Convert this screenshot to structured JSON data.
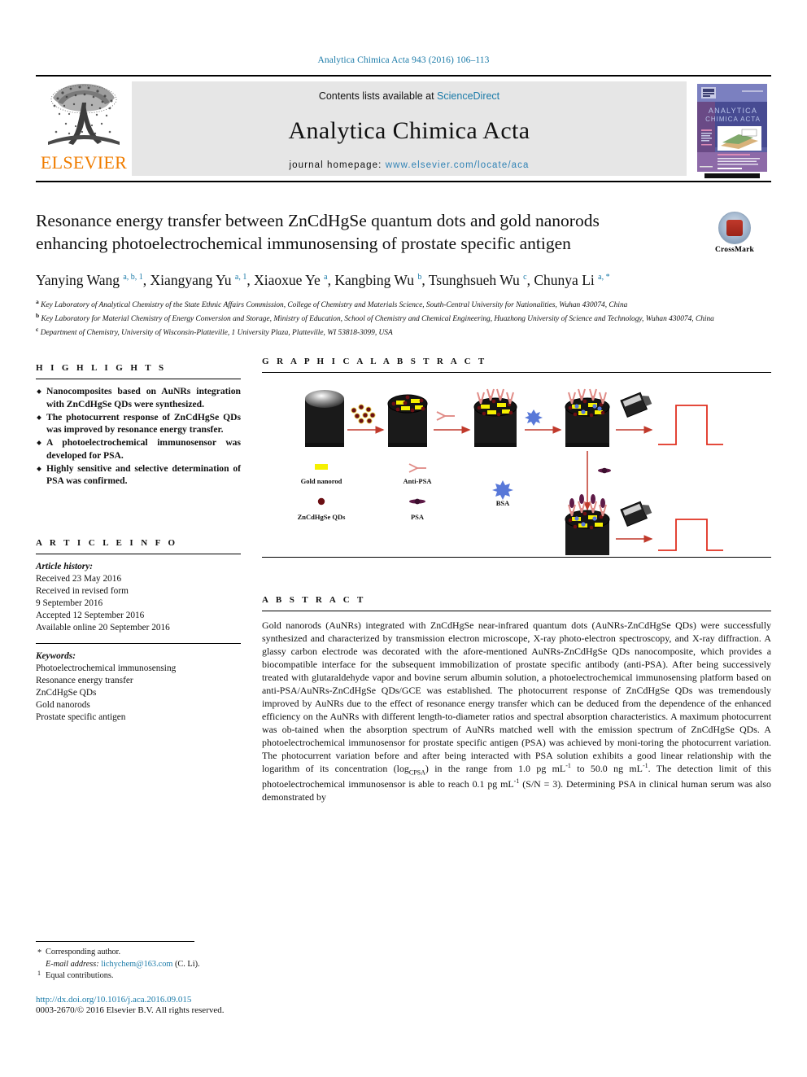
{
  "running_head": "Analytica Chimica Acta 943 (2016) 106–113",
  "masthead": {
    "publisher_name": "ELSEVIER",
    "contents_prefix": "Contents lists available at ",
    "contents_link": "ScienceDirect",
    "journal_name": "Analytica Chimica Acta",
    "homepage_prefix": "journal homepage: ",
    "homepage_link": "www.elsevier.com/locate/aca",
    "cover_title_line1": "ANALYTICA",
    "cover_title_line2": "CHIMICA ACTA"
  },
  "article": {
    "title": "Resonance energy transfer between ZnCdHgSe quantum dots and gold nanorods enhancing photoelectrochemical immunosensing of prostate specific antigen",
    "crossmark_label": "CrossMark",
    "authors_html": "Yanying Wang <sup>a, b, 1</sup>, Xiangyang Yu <sup>a, 1</sup>, Xiaoxue Ye <sup>a</sup>, Kangbing Wu <sup>b</sup>, Tsunghsueh Wu <sup>c</sup>, Chunya Li <sup>a, *</sup>",
    "affiliations": [
      "Key Laboratory of Analytical Chemistry of the State Ethnic Affairs Commission, College of Chemistry and Materials Science, South-Central University for Nationalities, Wuhan 430074, China",
      "Key Laboratory for Material Chemistry of Energy Conversion and Storage, Ministry of Education, School of Chemistry and Chemical Engineering, Huazhong University of Science and Technology, Wuhan 430074, China",
      "Department of Chemistry, University of Wisconsin-Platteville, 1 University Plaza, Platteville, WI 53818-3099, USA"
    ],
    "affiliation_markers": [
      "a",
      "b",
      "c"
    ]
  },
  "highlights": {
    "heading": "H I G H L I G H T S",
    "items": [
      "Nanocomposites based on AuNRs integration with ZnCdHgSe QDs were synthesized.",
      "The photocurrent response of ZnCdHgSe QDs was improved by resonance energy transfer.",
      "A photoelectrochemical immunosensor was developed for PSA.",
      "Highly sensitive and selective determination of PSA was confirmed."
    ]
  },
  "graphical_abstract": {
    "heading": "G R A P H I C A L   A B S T R A C T",
    "legend": [
      {
        "label": "Gold nanorod",
        "color": "#f5f000"
      },
      {
        "label": "ZnCdHgSe QDs",
        "color": "#6b0f13"
      },
      {
        "label": "Anti-PSA",
        "color": "#e08b86"
      },
      {
        "label": "PSA",
        "color": "#5e1a47"
      },
      {
        "label": "BSA",
        "color": "#5878d8"
      }
    ]
  },
  "article_info": {
    "heading": "A R T I C L E   I N F O",
    "history_label": "Article history:",
    "history": [
      "Received 23 May 2016",
      "Received in revised form",
      "9 September 2016",
      "Accepted 12 September 2016",
      "Available online 20 September 2016"
    ],
    "keywords_label": "Keywords:",
    "keywords": [
      "Photoelectrochemical immunosensing",
      "Resonance energy transfer",
      "ZnCdHgSe QDs",
      "Gold nanorods",
      "Prostate specific antigen"
    ]
  },
  "abstract": {
    "heading": "A B S T R A C T",
    "text_html": "Gold nanorods (AuNRs) integrated with ZnCdHgSe near-infrared quantum dots (AuNRs-ZnCdHgSe QDs) were successfully synthesized and characterized by transmission electron microscope, X-ray photo-electron spectroscopy, and X-ray diffraction. A glassy carbon electrode was decorated with the afore-mentioned AuNRs-ZnCdHgSe QDs nanocomposite, which provides a biocompatible interface for the subsequent immobilization of prostate specific antibody (anti-PSA). After being successively treated with glutaraldehyde vapor and bovine serum albumin solution, a photoelectrochemical immunosensing platform based on anti-PSA/AuNRs-ZnCdHgSe QDs/GCE was established. The photocurrent response of ZnCdHgSe QDs was tremendously improved by AuNRs due to the effect of resonance energy transfer which can be deduced from the dependence of the enhanced efficiency on the AuNRs with different length-to-diameter ratios and spectral absorption characteristics. A maximum photocurrent was ob-tained when the absorption spectrum of AuNRs matched well with the emission spectrum of ZnCdHgSe QDs. A photoelectrochemical immunosensor for prostate specific antigen (PSA) was achieved by moni-toring the photocurrent variation. The photocurrent variation before and after being interacted with PSA solution exhibits a good linear relationship with the logarithm of its concentration (log<sub>C</sub><sub>PSA</sub>) in the range from 1.0 pg mL<sup>-1</sup> to 50.0 ng mL<sup>-1</sup>. The detection limit of this photoelectrochemical immunosensor is able to reach 0.1 pg mL<sup>-1</sup> (S/N = 3). Determining PSA in clinical human serum was also demonstrated by"
  },
  "footer": {
    "corresponding_author": "Corresponding author.",
    "email_label": "E-mail address:",
    "email": "lichychem@163.com",
    "email_suffix": "(C. Li).",
    "equal_contributions": "Equal contributions.",
    "doi": "http://dx.doi.org/10.1016/j.aca.2016.09.015",
    "copyright": "0003-2670/© 2016 Elsevier B.V. All rights reserved."
  }
}
